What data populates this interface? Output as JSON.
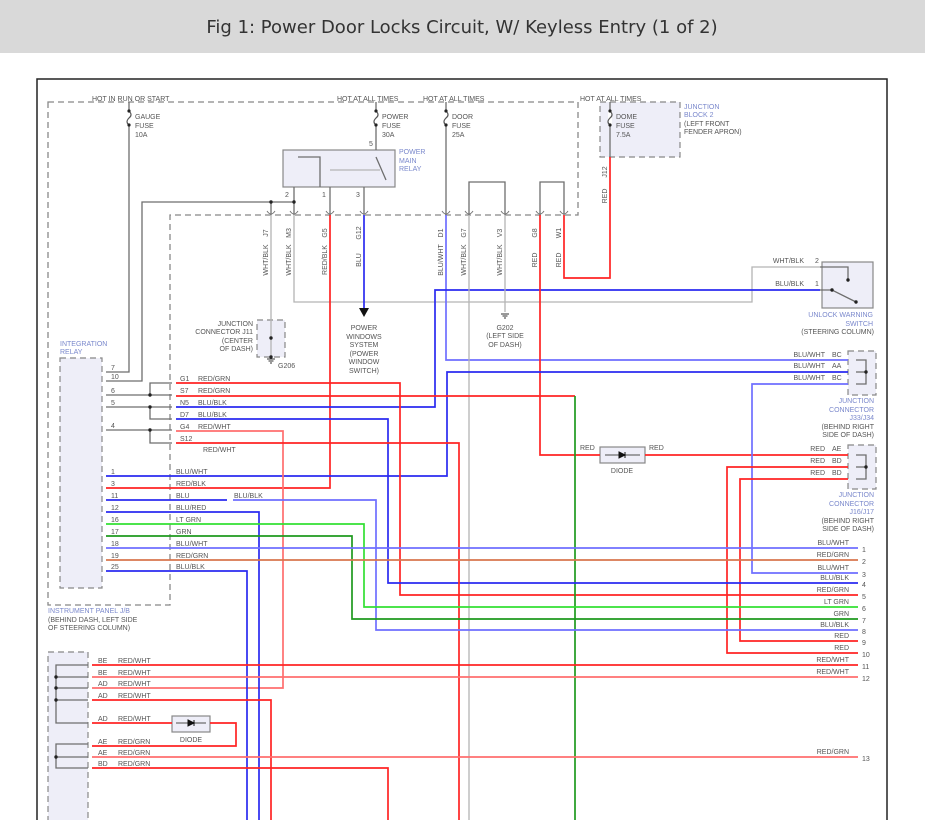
{
  "title": "Fig 1: Power Door Locks Circuit, W/ Keyless Entry (1 of 2)",
  "colors": {
    "red": "#ff2424",
    "pink": "#ff6e6e",
    "blue": "#2b2bf0",
    "light_blue": "#6f6fff",
    "gray": "#b4b4b4",
    "dark_gray": "#6e6e6e",
    "lt_grn": "#33e033",
    "grn": "#1f9a1f",
    "brown": "#d8764e",
    "box_fill": "#eeeef8",
    "label_blue": "#7a88cc"
  },
  "power": {
    "run_start": "HOT IN RUN OR START",
    "hot1": "HOT AT ALL TIMES",
    "hot2": "HOT AT ALL TIMES",
    "hot3": "HOT AT ALL TIMES"
  },
  "fuses": {
    "gauge": [
      "GAUGE",
      "FUSE",
      "10A"
    ],
    "power": [
      "POWER",
      "FUSE",
      "30A"
    ],
    "door": [
      "DOOR",
      "FUSE",
      "25A"
    ],
    "dome": [
      "DOME",
      "FUSE",
      "7.5A"
    ]
  },
  "junction_block2": [
    "JUNCTION",
    "BLOCK 2",
    "(LEFT FRONT",
    "FENDER APRON)"
  ],
  "relay": {
    "label": [
      "POWER",
      "MAIN",
      "RELAY"
    ],
    "pins": [
      "2",
      "1",
      "3",
      "5"
    ]
  },
  "jb_pins": [
    {
      "code": "J7",
      "wire": "WHT/BLK"
    },
    {
      "code": "M3",
      "wire": "WHT/BLK"
    },
    {
      "code": "G5",
      "wire": "RED/BLK"
    },
    {
      "code": "G12",
      "wire": "BLU"
    },
    {
      "code": "D1",
      "wire": "BLU/WHT"
    },
    {
      "code": "G7",
      "wire": "WHT/BLK"
    },
    {
      "code": "V3",
      "wire": "WHT/BLK"
    },
    {
      "code": "G8",
      "wire": "RED"
    },
    {
      "code": "W1",
      "wire": "RED"
    }
  ],
  "dome_pin": {
    "code": "J12",
    "wire": "RED"
  },
  "j11": [
    "JUNCTION",
    "CONNECTOR J11",
    "(CENTER",
    "OF DASH)",
    "G206"
  ],
  "power_windows": [
    "POWER",
    "WINDOWS",
    "SYSTEM",
    "(POWER",
    "WINDOW",
    "SWITCH)"
  ],
  "g202": [
    "G202",
    "(LEFT SIDE",
    "OF DASH)"
  ],
  "unlock_switch": {
    "pins": [
      {
        "wire": "WHT/BLK",
        "pin": "2"
      },
      {
        "wire": "BLU/BLK",
        "pin": "1"
      }
    ],
    "label": [
      "UNLOCK WARNING",
      "SWITCH",
      "(STEERING COLUMN)"
    ]
  },
  "j33": {
    "pins": [
      {
        "wire": "BLU/WHT",
        "code": "BC"
      },
      {
        "wire": "BLU/WHT",
        "code": "AA"
      },
      {
        "wire": "BLU/WHT",
        "code": "BC"
      }
    ],
    "label": [
      "JUNCTION",
      "CONNECTOR",
      "J33/J34",
      "(BEHIND RIGHT",
      "SIDE OF DASH)"
    ]
  },
  "j16": {
    "pins": [
      {
        "wire": "RED",
        "code": "AE"
      },
      {
        "wire": "RED",
        "code": "BD"
      },
      {
        "wire": "RED",
        "code": "BD"
      }
    ],
    "label": [
      "JUNCTION",
      "CONNECTOR",
      "J16/J17",
      "(BEHIND RIGHT",
      "SIDE OF DASH)"
    ]
  },
  "diode": {
    "label": "DIODE",
    "left": "RED",
    "right": "RED"
  },
  "integration_relay": {
    "label": [
      "INTEGRATION",
      "RELAY"
    ],
    "pins": [
      {
        "pin": "7"
      },
      {
        "pin": "10"
      },
      {
        "pin": "6"
      },
      {
        "pin": "5"
      },
      {
        "pin": "4"
      },
      {
        "pin": "1",
        "wire": "BLU/WHT"
      },
      {
        "pin": "3",
        "wire": "RED/BLK"
      },
      {
        "pin": "11",
        "wire": "BLU",
        "wire2": "BLU/BLK"
      },
      {
        "pin": "12",
        "wire": "BLU/RED"
      },
      {
        "pin": "16",
        "wire": "LT GRN"
      },
      {
        "pin": "17",
        "wire": "GRN"
      },
      {
        "pin": "18",
        "wire": "BLU/WHT"
      },
      {
        "pin": "19",
        "wire": "RED/GRN"
      },
      {
        "pin": "25",
        "wire": "BLU/BLK"
      }
    ]
  },
  "ip_jb": {
    "label": [
      "INSTRUMENT PANEL J/B",
      "(BEHIND DASH, LEFT SIDE",
      "OF STEERING COLUMN)"
    ],
    "pins": [
      {
        "code": "G1",
        "wire": "RED/GRN"
      },
      {
        "code": "S7",
        "wire": "RED/GRN"
      },
      {
        "code": "N5",
        "wire": "BLU/BLK"
      },
      {
        "code": "D7",
        "wire": "BLU/BLK"
      },
      {
        "code": "G4",
        "wire": "RED/WHT"
      },
      {
        "code": "S12",
        "wire": "RED/WHT"
      }
    ]
  },
  "lower_connector": {
    "pins": [
      {
        "code": "BE",
        "wire": "RED/WHT"
      },
      {
        "code": "BE",
        "wire": "RED/WHT"
      },
      {
        "code": "AD",
        "wire": "RED/WHT"
      },
      {
        "code": "AD",
        "wire": "RED/WHT"
      },
      {
        "code": "AD",
        "wire": "RED/WHT"
      },
      {
        "code": "AE",
        "wire": "RED/GRN"
      },
      {
        "code": "AE",
        "wire": "RED/GRN"
      },
      {
        "code": "BD",
        "wire": "RED/GRN"
      }
    ],
    "diode": "DIODE"
  },
  "outputs": [
    {
      "n": "1",
      "wire": "BLU/WHT"
    },
    {
      "n": "2",
      "wire": "RED/GRN"
    },
    {
      "n": "3",
      "wire": "BLU/WHT"
    },
    {
      "n": "4",
      "wire": "BLU/BLK"
    },
    {
      "n": "5",
      "wire": "RED/GRN"
    },
    {
      "n": "6",
      "wire": "LT GRN"
    },
    {
      "n": "7",
      "wire": "GRN"
    },
    {
      "n": "8",
      "wire": "BLU/BLK"
    },
    {
      "n": "9",
      "wire": "RED"
    },
    {
      "n": "10",
      "wire": "RED"
    },
    {
      "n": "11",
      "wire": "RED/WHT"
    },
    {
      "n": "12",
      "wire": "RED/WHT"
    },
    {
      "n": "13",
      "wire": "RED/GRN"
    }
  ]
}
